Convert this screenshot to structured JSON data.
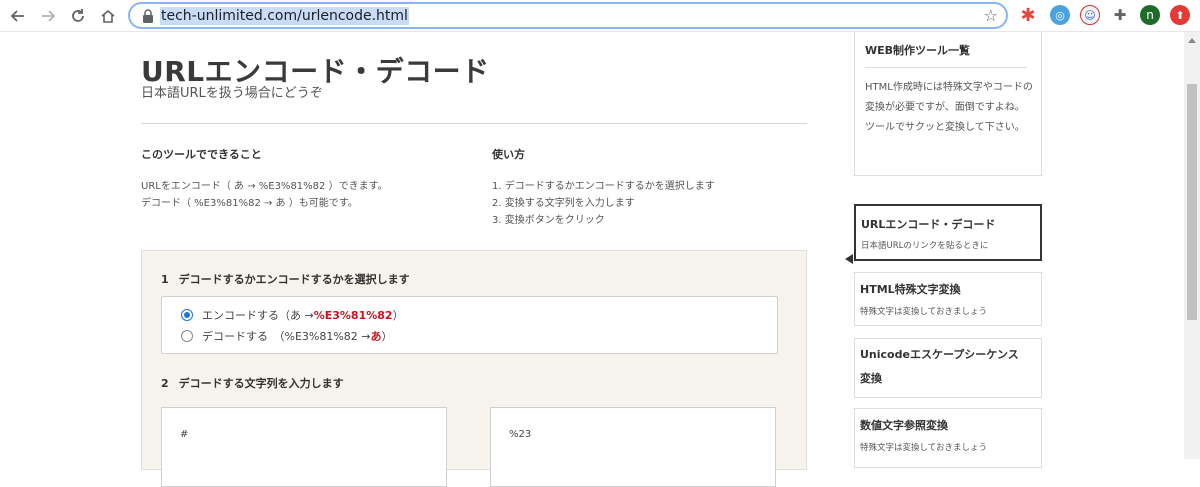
{
  "browser": {
    "url": "tech-unlimited.com/urlencode.html",
    "avatar_letter": "n",
    "colors": {
      "omnibox_border": "#8ab4f8",
      "selection": "#c8dcf8"
    }
  },
  "header": {
    "title": "URLエンコード・デコード",
    "subtitle": "日本語URLを扱う場合にどうぞ"
  },
  "intro": {
    "what_heading": "このツールでできること",
    "what_line1": "URLをエンコード（ あ → %E3%81%82 ）できます。",
    "what_line2": "デコード（ %E3%81%82 → あ ）も可能です。",
    "how_heading": "使い方",
    "how_steps": [
      "1. デコードするかエンコードするかを選択します",
      "2. 変換する文字列を入力します",
      "3. 変換ボタンをクリック"
    ]
  },
  "form": {
    "step1_num": "1",
    "step1_label": "デコードするかエンコードするかを選択します",
    "encode_label": "エンコードする（あ → ",
    "encode_value": "%E3%81%82",
    "encode_close": "）",
    "decode_label": "デコードする　（%E3%81%82 → ",
    "decode_value": "あ",
    "decode_close": "）",
    "selected": "encode",
    "step2_num": "2",
    "step2_label": "デコードする文字列を入力します",
    "input_value": "#",
    "output_value": "%23"
  },
  "sidebar": {
    "tools_title": "WEB制作ツール一覧",
    "tools_desc": "HTML作成時には特殊文字やコードの変換が必要ですが、面倒ですよね。ツールでサクッと変換して下さい。",
    "items": [
      {
        "title": "URLエンコード・デコード",
        "desc": "日本語URLのリンクを貼るときに",
        "active": true
      },
      {
        "title": "HTML特殊文字変換",
        "desc": "特殊文字は変換しておきましょう"
      },
      {
        "title": "Unicodeエスケープシーケンス",
        "title2": "変換"
      },
      {
        "title": "数値文字参照変換",
        "desc": "特殊文字は変換しておきましょう"
      }
    ]
  }
}
